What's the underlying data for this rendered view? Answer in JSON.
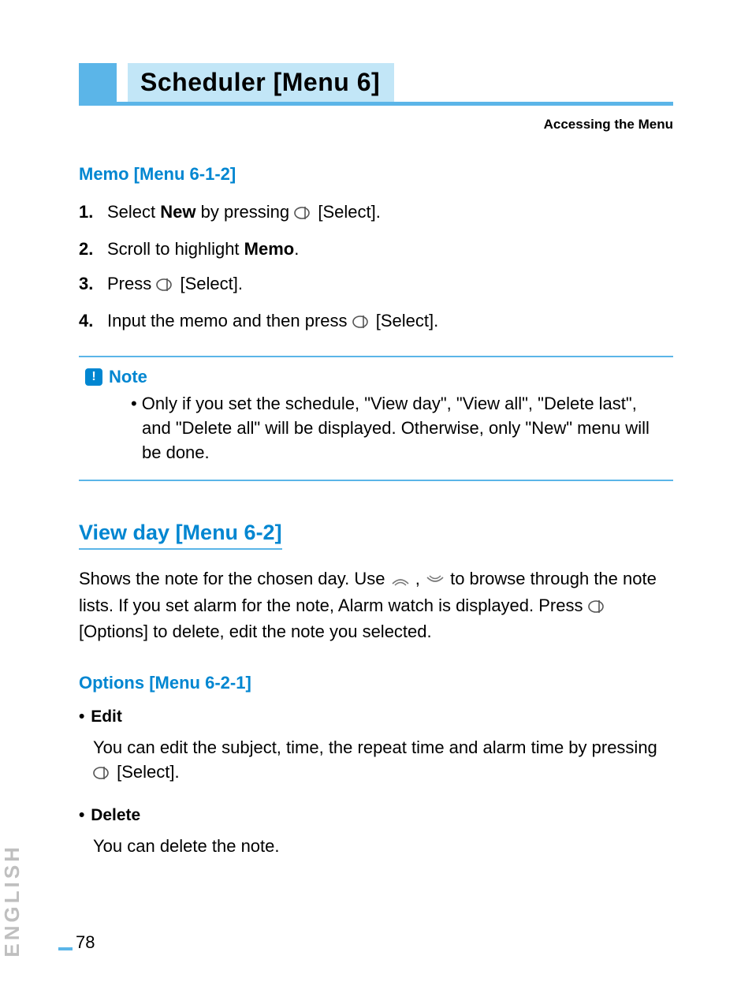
{
  "title": "Scheduler [Menu 6]",
  "subtitle_right": "Accessing the Menu",
  "memo": {
    "heading": "Memo [Menu 6-1-2]",
    "steps": [
      {
        "num": "1.",
        "pre": "Select ",
        "bold": "New",
        "post": " by pressing ",
        "suffix": " [Select]."
      },
      {
        "num": "2.",
        "pre": "Scroll to highlight ",
        "bold": "Memo",
        "post": "."
      },
      {
        "num": "3.",
        "pre": "Press ",
        "suffix": " [Select]."
      },
      {
        "num": "4.",
        "pre": "Input the memo and then press ",
        "suffix": " [Select]."
      }
    ]
  },
  "note": {
    "label": "Note",
    "bullet": "•",
    "body": "Only if you set the schedule, \"View day\", \"View all\", \"Delete last\", and \"Delete all\" will be displayed. Otherwise, only \"New\" menu will be done."
  },
  "viewday": {
    "heading": "View day [Menu 6-2]",
    "para_a": "Shows the note for the chosen day. Use ",
    "para_b": " , ",
    "para_c": " to browse through the note lists. If you set alarm for the note, Alarm watch is displayed. Press ",
    "para_d": " [Options] to delete, edit the note you selected."
  },
  "options": {
    "heading": "Options [Menu 6-2-1]",
    "items": [
      {
        "name": "Edit",
        "body_a": "You can edit the subject, time, the repeat time and alarm time by pressing ",
        "body_b": " [Select]."
      },
      {
        "name": "Delete",
        "body_a": "You can delete the note."
      }
    ]
  },
  "side_tab": "ENGLISH",
  "page_number": "78",
  "glyphs": {
    "dot": "•",
    "bang": "!"
  }
}
